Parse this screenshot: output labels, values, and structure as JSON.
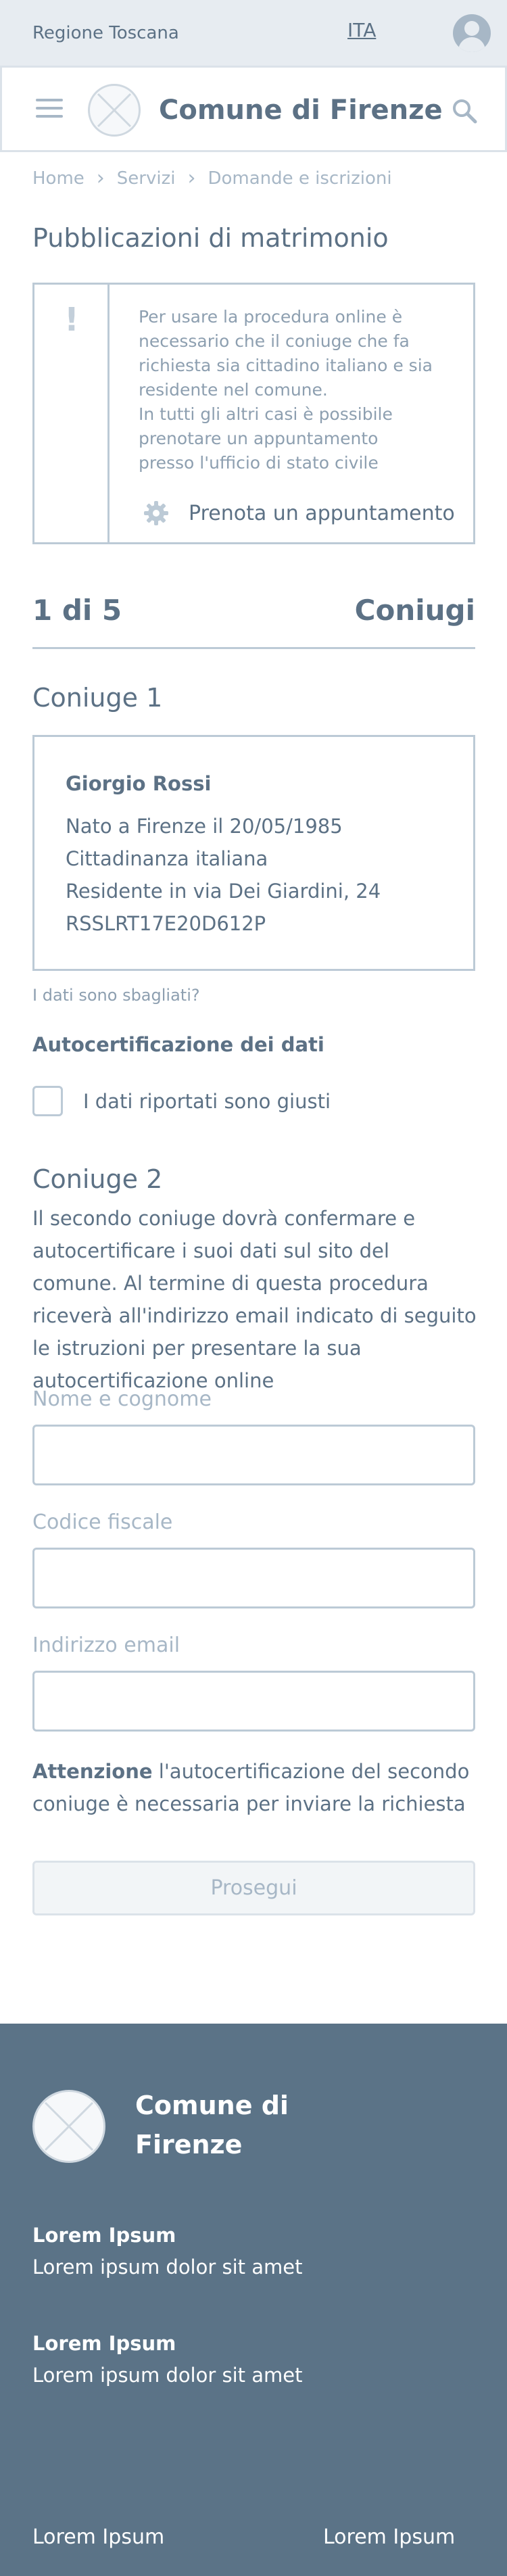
{
  "topbar": {
    "region": "Regione Toscana",
    "language": "ITA"
  },
  "header": {
    "title": "Comune di Firenze"
  },
  "breadcrumb": [
    "Home",
    "Servizi",
    "Domande e iscrizioni"
  ],
  "page_title": "Pubblicazioni di matrimonio",
  "notice": {
    "text_1": "Per usare la procedura online è necessario che il coniuge che fa richiesta sia cittadino italiano e sia residente nel comune.",
    "text_2": "In tutti gli altri casi è possibile prenotare un appuntamento presso l'ufficio di stato civile",
    "appointment_label": "Prenota un appuntamento"
  },
  "steps": {
    "counter": "1 di 5",
    "current": "Coniugi"
  },
  "spouse1": {
    "title": "Coniuge 1",
    "name": "Giorgio Rossi",
    "lines": [
      "Nato a Firenze il 20/05/1985",
      "Cittadinanza italiana",
      "Residente in via Dei Giardini, 24",
      "RSSLRT17E20D612P"
    ],
    "wrong_data_link": "I dati sono sbagliati?",
    "self_cert_heading": "Autocertificazione dei dati",
    "checkbox_label": "I dati riportati sono giusti",
    "checkbox_checked": false
  },
  "spouse2": {
    "title": "Coniuge 2",
    "description": "Il secondo coniuge dovrà confermare e autocertificare i suoi dati sul sito del comune. Al termine di questa procedura riceverà all'indirizzo email indicato di seguito le istruzioni per presentare la sua autocertificazione online",
    "fields": [
      {
        "label": "Nome e cognome",
        "value": ""
      },
      {
        "label": "Codice fiscale",
        "value": ""
      },
      {
        "label": "Indirizzo email",
        "value": ""
      }
    ],
    "attention_bold": "Attenzione",
    "attention_text": " l'autocertificazione del secondo coniuge è necessaria per inviare la richiesta",
    "continue_label": "Prosegui"
  },
  "footer": {
    "title": "Comune di Firenze",
    "blocks": [
      {
        "heading": "Lorem Ipsum",
        "text": "Lorem ipsum dolor sit amet"
      },
      {
        "heading": "Lorem Ipsum",
        "text": "Lorem ipsum dolor sit amet"
      }
    ],
    "links": [
      "Lorem Ipsum",
      "Lorem Ipsum"
    ]
  },
  "colors": {
    "primary_text": "#5c7185",
    "muted_text": "#a7b7c6",
    "border": "#bccad6",
    "topbar_bg": "#e7ecf1",
    "footer_bg": "#5b7387"
  },
  "icons": [
    "hamburger-menu-icon",
    "search-icon",
    "user-avatar-icon",
    "exclamation-icon",
    "gear-icon",
    "chevron-right-icon"
  ]
}
